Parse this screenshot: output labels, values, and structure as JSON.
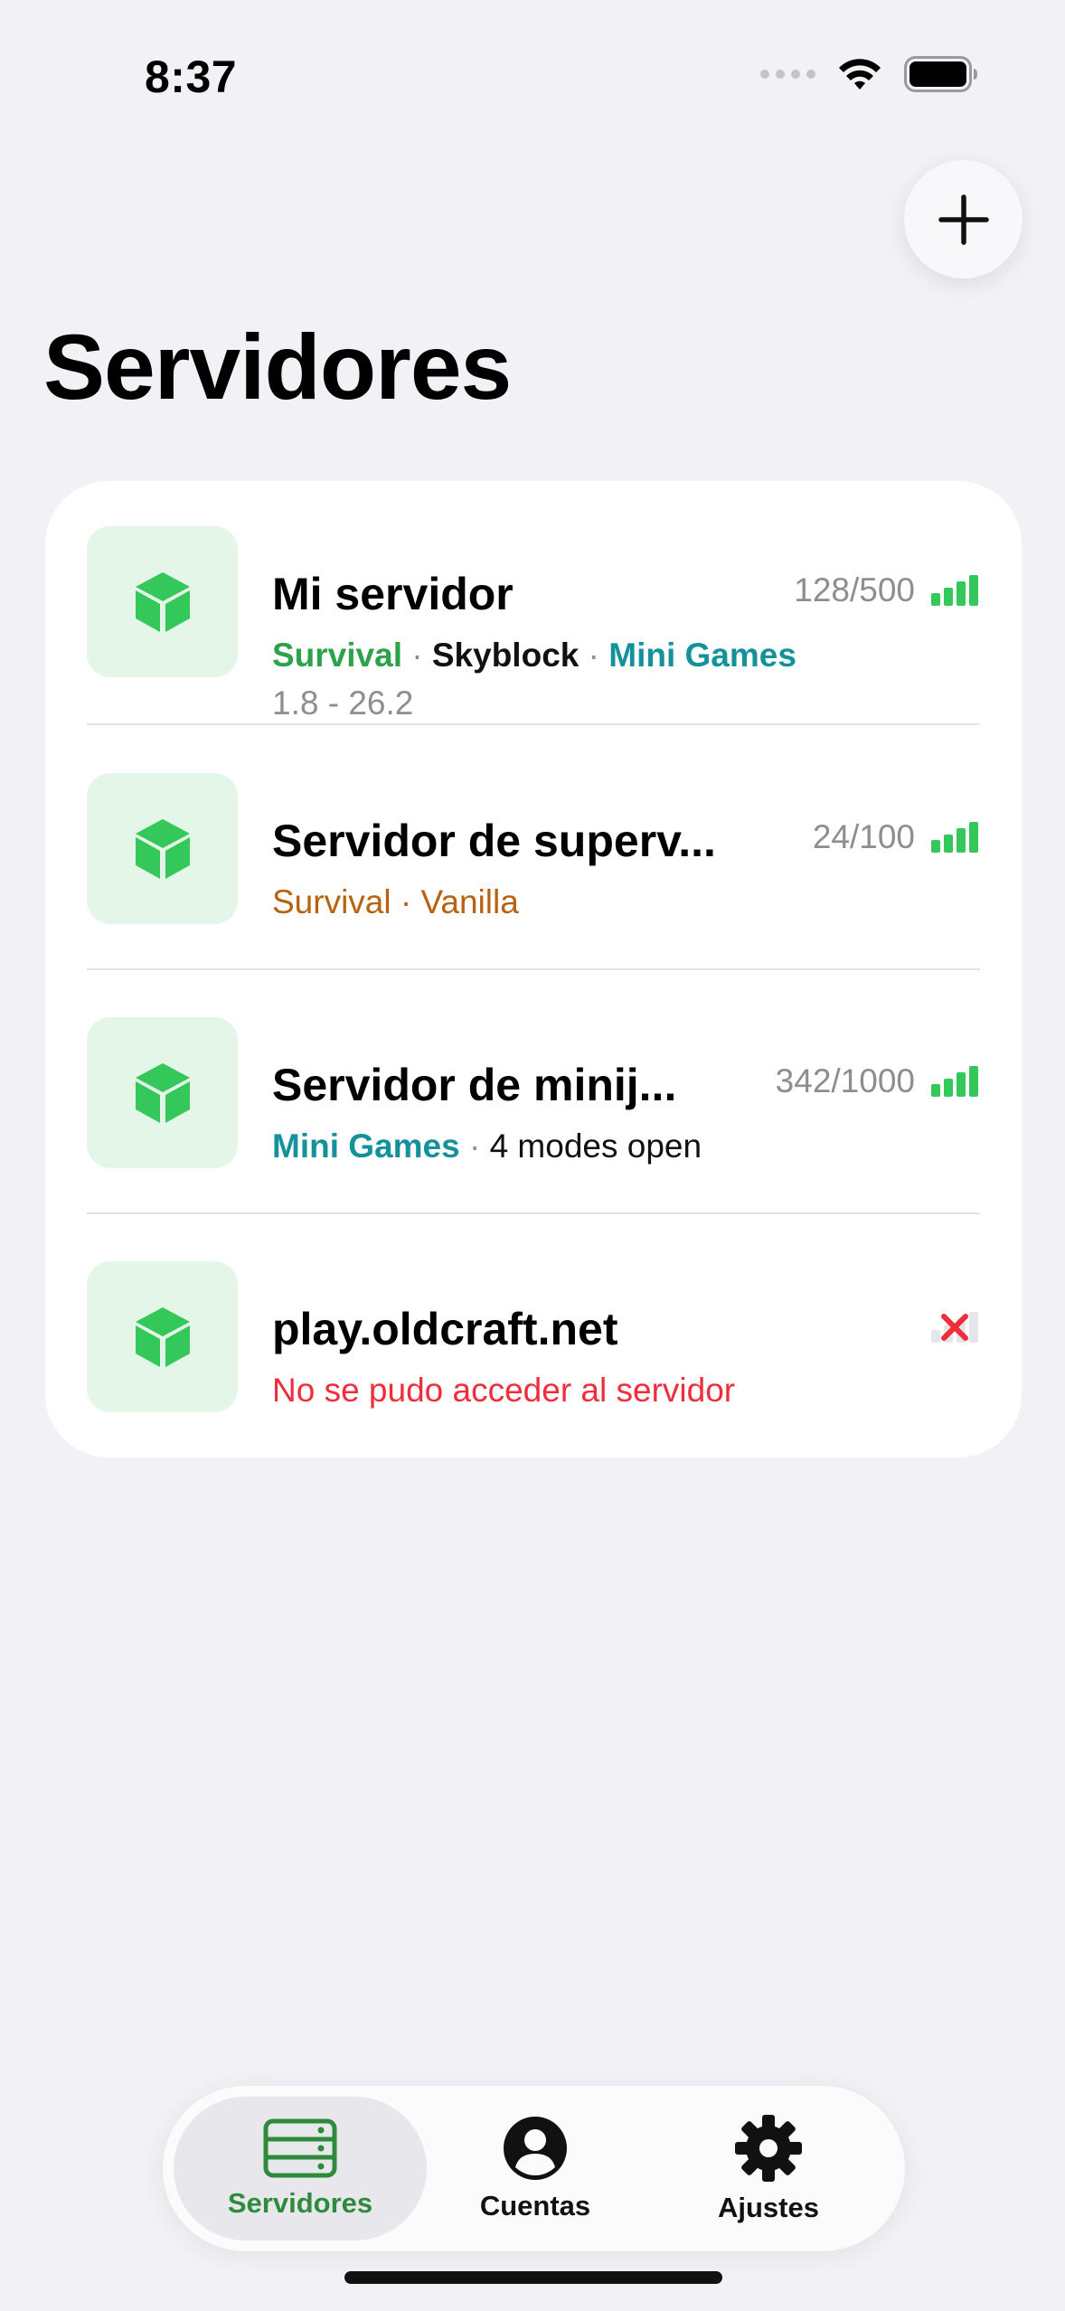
{
  "status_bar": {
    "time": "8:37"
  },
  "header": {
    "title": "Servidores",
    "add_icon": "plus-icon"
  },
  "servers": [
    {
      "name": "Mi servidor",
      "players": "128/500",
      "tags": [
        {
          "text": "Survival",
          "color": "#2ea24a"
        },
        {
          "text": "Skyblock",
          "color": "#111111"
        },
        {
          "text": "Mini Games",
          "color": "#15919c"
        }
      ],
      "version": "1.8 - 26.2",
      "status": "online"
    },
    {
      "name": "Servidor de superv...",
      "players": "24/100",
      "tags": [
        {
          "text": "Survival",
          "color": "#b8620f"
        },
        {
          "text": "Vanilla",
          "color": "#b8620f"
        }
      ],
      "status": "online"
    },
    {
      "name": "Servidor de minij...",
      "players": "342/1000",
      "tags": [
        {
          "text": "Mini Games",
          "color": "#15919c"
        },
        {
          "text": "4 modes open",
          "color": "#111111"
        }
      ],
      "status": "online"
    },
    {
      "name": "play.oldcraft.net",
      "error": "No se pudo acceder al servidor",
      "status": "offline"
    }
  ],
  "separator": "·",
  "tabbar": {
    "tabs": [
      {
        "label": "Servidores",
        "icon": "server-icon",
        "active": true
      },
      {
        "label": "Cuentas",
        "icon": "account-icon",
        "active": false
      },
      {
        "label": "Ajustes",
        "icon": "gear-icon",
        "active": false
      }
    ]
  },
  "colors": {
    "accent": "#2e8b3c",
    "online": "#34c759",
    "error": "#ef2d3b",
    "icon_tile": "#e4f6e8"
  }
}
